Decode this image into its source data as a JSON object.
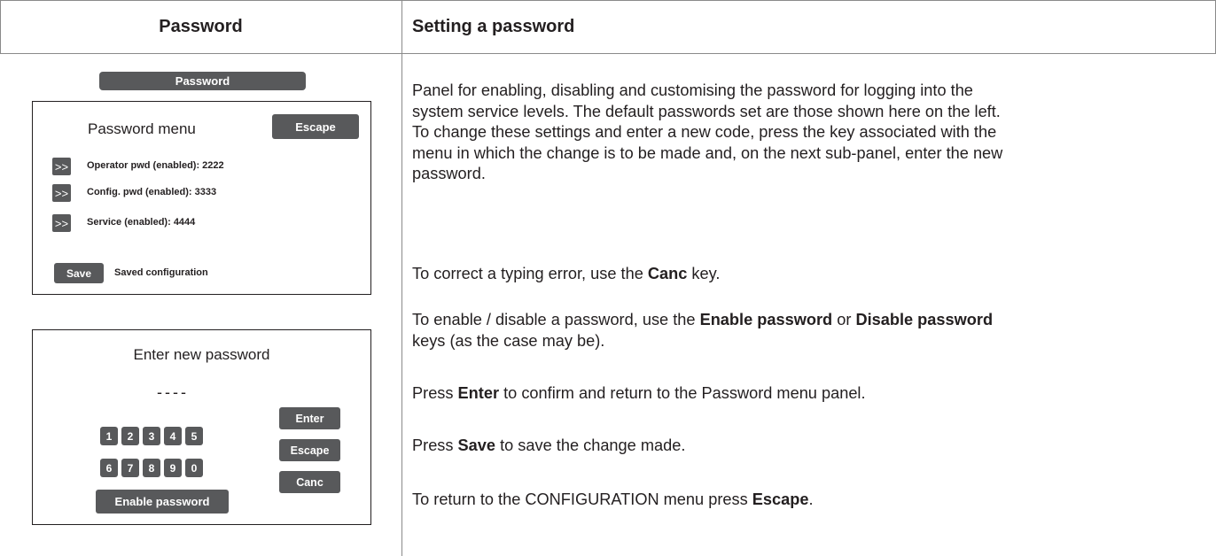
{
  "header": {
    "left_title": "Password",
    "right_title": "Setting a password"
  },
  "menu_panel": {
    "title_bar": "Password",
    "heading": "Password menu",
    "escape_label": "Escape",
    "arrow_label": ">>",
    "rows": [
      "Operator pwd (enabled): 2222",
      "Config. pwd (enabled): 3333",
      "Service (enabled): 4444"
    ],
    "save_label": "Save",
    "saved_text": "Saved configuration"
  },
  "new_password_panel": {
    "heading": "Enter new password",
    "dashes": "----",
    "digits_row1": [
      "1",
      "2",
      "3",
      "4",
      "5"
    ],
    "digits_row2": [
      "6",
      "7",
      "8",
      "9",
      "0"
    ],
    "enable_label": "Enable password",
    "enter_label": "Enter",
    "escape_label": "Escape",
    "canc_label": "Canc"
  },
  "description": {
    "intro": "Panel for enabling, disabling and customising the password for logging into the system service levels. The default passwords set are those shown here on the left. To change these settings and enter a new code, press the key associated with the menu in which the change is to be made and, on the next sub-panel, enter the new password.",
    "intro_lines": [
      "Panel for enabling, disabling and customising the password for logging into the",
      "system service levels. The default passwords set are those shown here on the left.",
      "To change these settings and enter a new code, press the key associated with the",
      "menu in which the change is to be made and, on the next sub-panel, enter the new",
      "password."
    ],
    "canc": {
      "pre": "To correct a typing error, use the ",
      "key": "Canc",
      "post": " key."
    },
    "enable": {
      "pre": "To enable / disable a password, use the ",
      "key1": "Enable password",
      "mid": " or ",
      "key2": "Disable password",
      "line2": "keys (as the case may be)."
    },
    "enter": {
      "pre": "Press ",
      "key": "Enter",
      "post": " to confirm and return to the Password menu panel."
    },
    "save": {
      "pre": "Press ",
      "key": "Save",
      "post": " to save the change made."
    },
    "escape": {
      "pre": "To return to the CONFIGURATION menu press ",
      "key": "Escape",
      "post": "."
    }
  }
}
